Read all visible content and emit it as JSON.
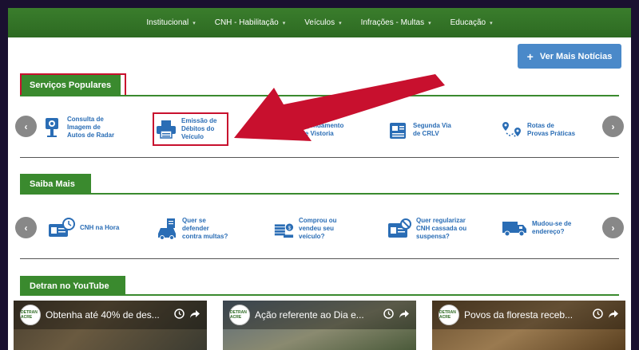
{
  "nav": {
    "items": [
      {
        "label": "Institucional",
        "has_dropdown": true
      },
      {
        "label": "CNH - Habilitação",
        "has_dropdown": true
      },
      {
        "label": "Veículos",
        "has_dropdown": true
      },
      {
        "label": "Infrações - Multas",
        "has_dropdown": true
      },
      {
        "label": "Educação",
        "has_dropdown": true
      }
    ],
    "caret": "▾"
  },
  "header_button": {
    "label": "Ver Mais Notícias",
    "icon": "plus-icon",
    "plus": "+"
  },
  "servicos": {
    "title": "Serviços Populares",
    "prev": "‹",
    "next": "›",
    "items": [
      {
        "label": "Consulta de\nImagem de\nAutos de Radar",
        "icon": "radar-camera-icon"
      },
      {
        "label": "Emissão de\nDébitos do\nVeículo",
        "icon": "printer-icon"
      },
      {
        "label": "Agendamento\nde Vistoria",
        "icon": "calendar-icon"
      },
      {
        "label": "Segunda Via\nde CRLV",
        "icon": "document-icon"
      },
      {
        "label": "Rotas de\nProvas Práticas",
        "icon": "map-route-icon"
      }
    ]
  },
  "saiba": {
    "title": "Saiba Mais",
    "prev": "‹",
    "next": "›",
    "items": [
      {
        "label": "CNH na Hora",
        "icon": "id-card-clock-icon"
      },
      {
        "label": "Quer se\ndefender\ncontra multas?",
        "icon": "car-ticket-icon"
      },
      {
        "label": "Comprou ou\nvendeu seu\nveículo?",
        "icon": "money-icon"
      },
      {
        "label": "Quer regularizar\nCNH cassada ou\nsuspensa?",
        "icon": "card-blocked-icon"
      },
      {
        "label": "Mudou-se de\nendereço?",
        "icon": "truck-icon"
      }
    ]
  },
  "youtube": {
    "title": "Detran no YouTube",
    "channel_logo_text": "DETRAN ACRE",
    "videos": [
      {
        "title": "Obtenha até 40% de des..."
      },
      {
        "title": "Ação referente ao Dia e..."
      },
      {
        "title": "Povos da floresta receb..."
      }
    ]
  },
  "colors": {
    "nav_green": "#2d6a22",
    "section_green": "#3a8a2e",
    "link_blue": "#2a6db5",
    "highlight_red": "#c8102e",
    "button_blue": "#4a89c9"
  }
}
